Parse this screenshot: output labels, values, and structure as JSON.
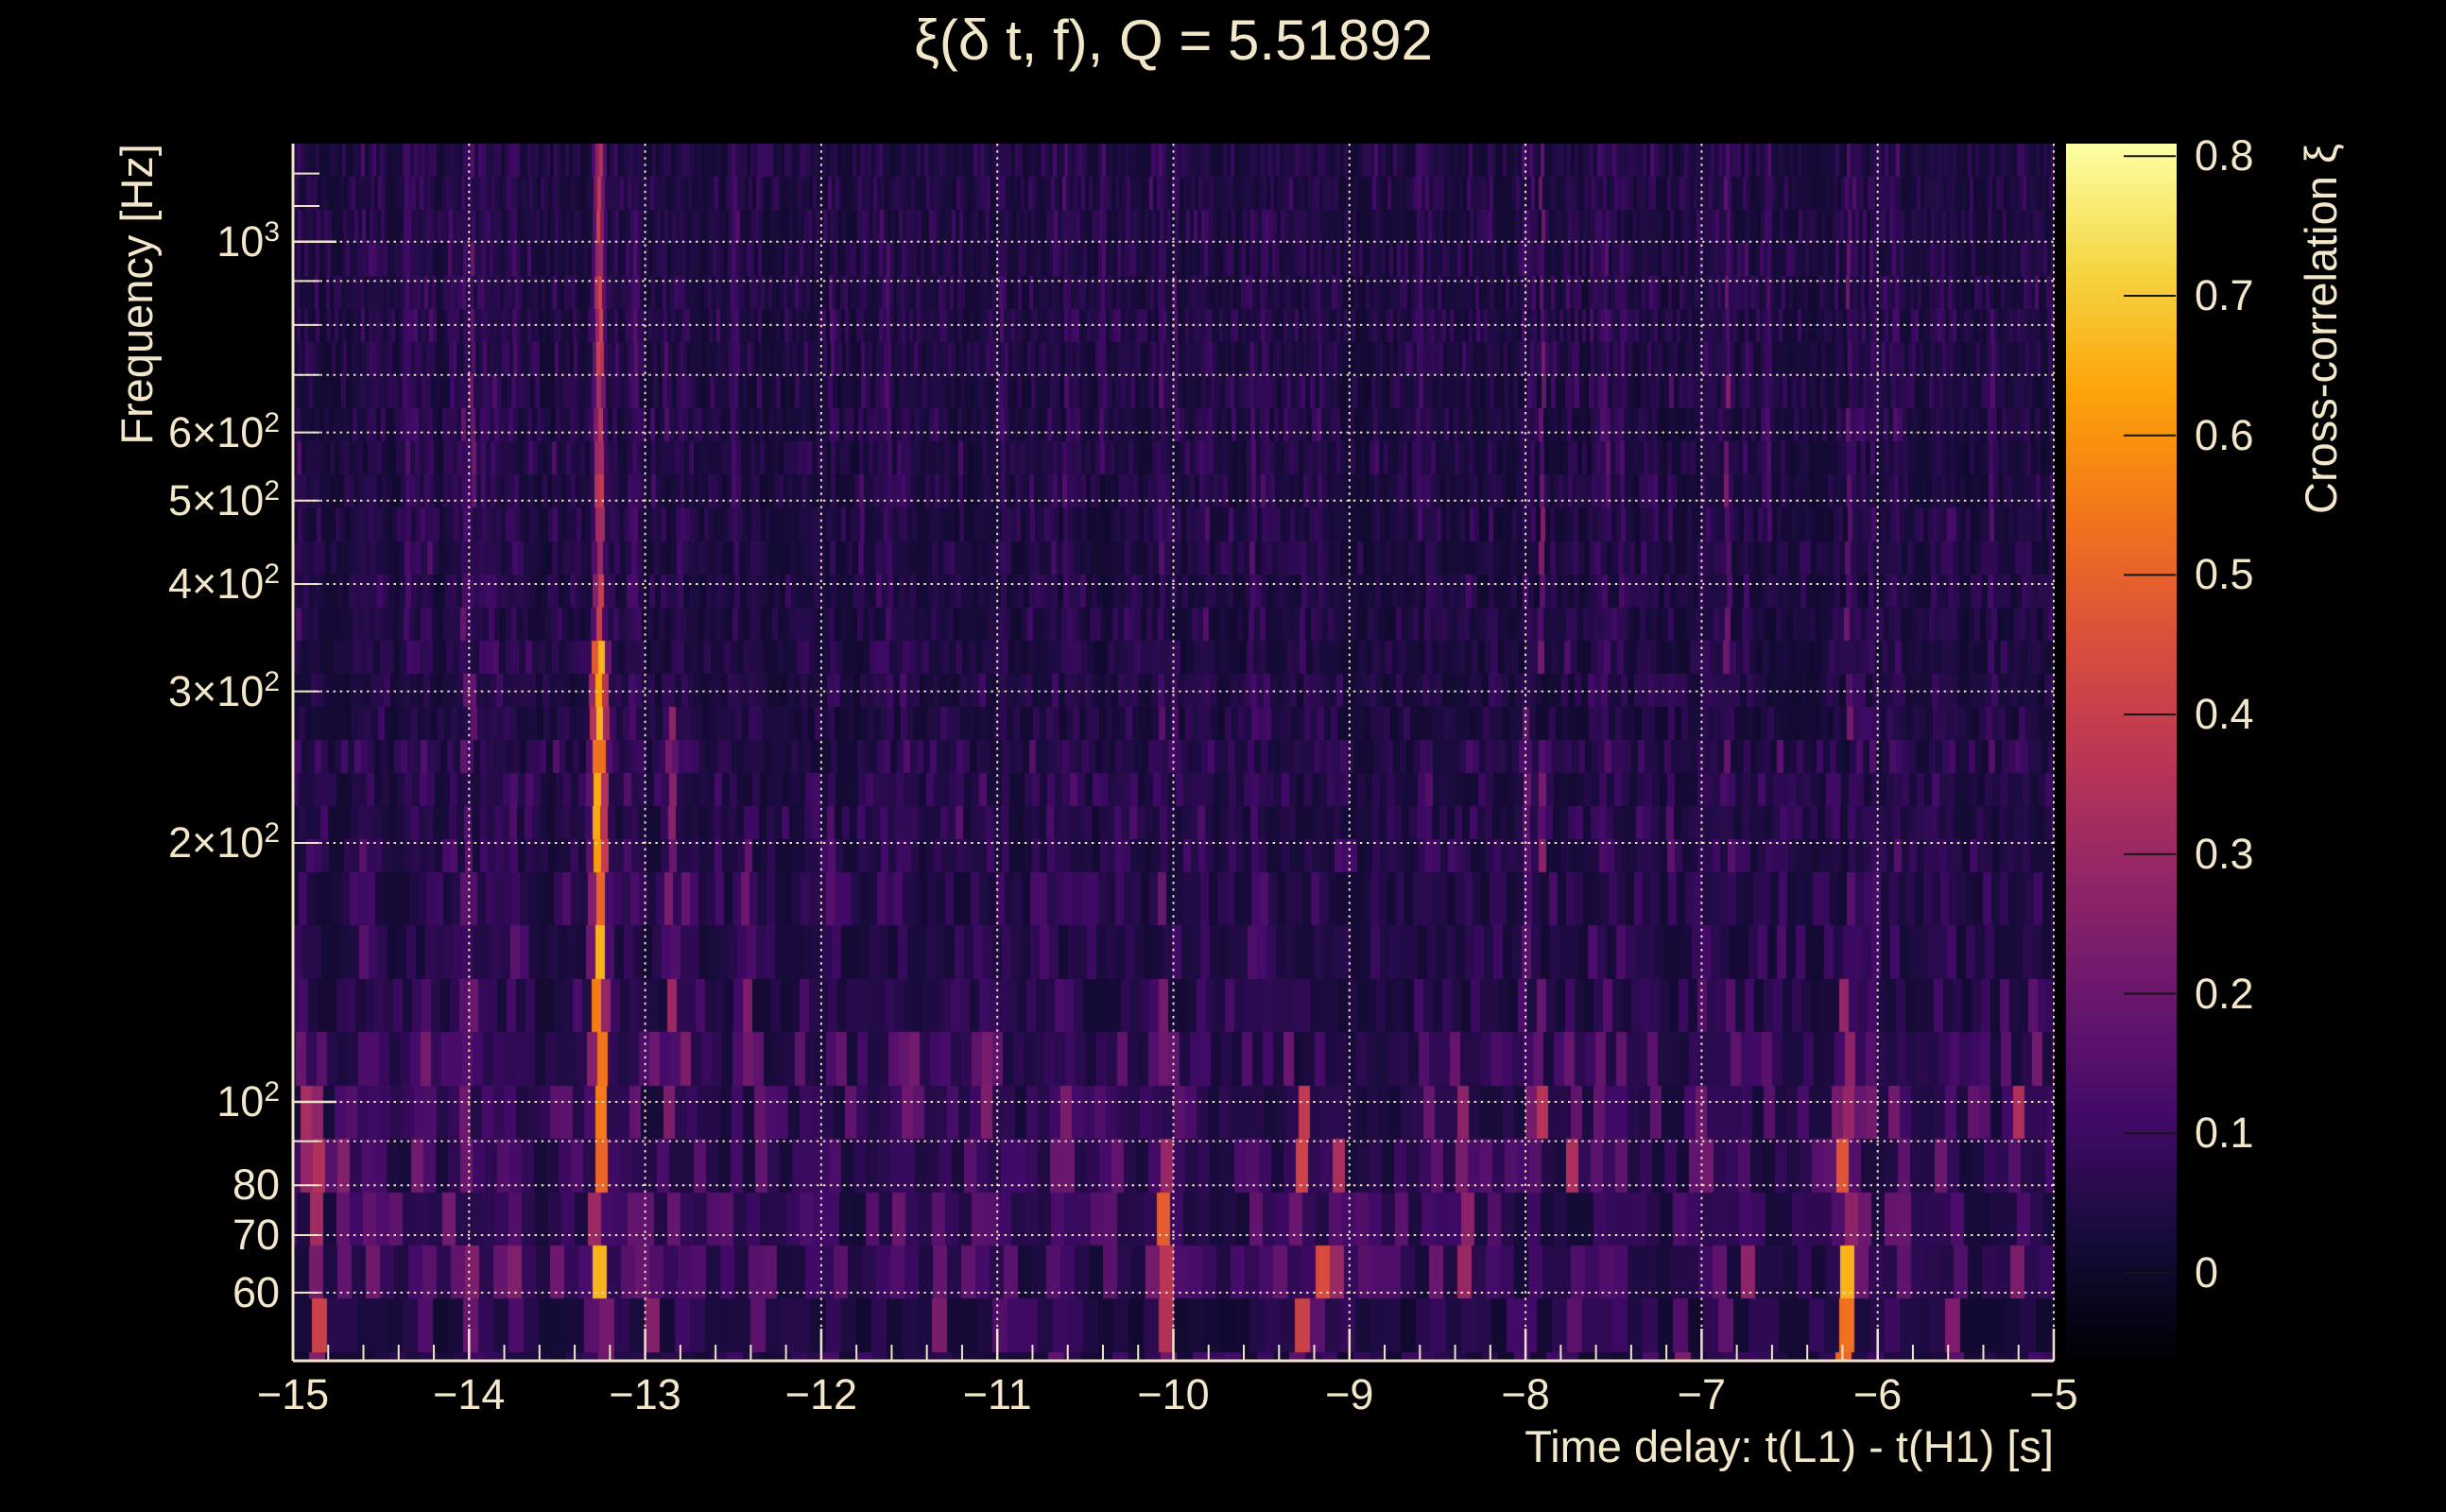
{
  "page": {
    "background": "#000000"
  },
  "colors": {
    "text": "#f2e7c9",
    "grid": "#ece0bf",
    "axis": "#efe5c6",
    "colorbar_tick": "#141414"
  },
  "chart_data": {
    "type": "heatmap",
    "title": "ξ(δ t, f), Q = 5.51892",
    "grid": "dotted",
    "noise_seed": 7,
    "x_axis": {
      "label": "Time delay: t(L1) - t(H1) [s]",
      "min": -15,
      "max": -5,
      "minor_tick_step": 0.2,
      "ticks": [
        {
          "value": -15,
          "label": "−15"
        },
        {
          "value": -14,
          "label": "−14"
        },
        {
          "value": -13,
          "label": "−13"
        },
        {
          "value": -12,
          "label": "−12"
        },
        {
          "value": -11,
          "label": "−11"
        },
        {
          "value": -10,
          "label": "−10"
        },
        {
          "value": -9,
          "label": "−9"
        },
        {
          "value": -8,
          "label": "−8"
        },
        {
          "value": -7,
          "label": "−7"
        },
        {
          "value": -6,
          "label": "−6"
        },
        {
          "value": -5,
          "label": "−5"
        }
      ]
    },
    "y_axis": {
      "label": "Frequency [Hz]",
      "scale": "log",
      "min": 50,
      "max": 1300,
      "ticks": [
        {
          "value": 1000,
          "base": "10",
          "exp": "3"
        },
        {
          "value": 600,
          "base": "6×10",
          "exp": "2"
        },
        {
          "value": 500,
          "base": "5×10",
          "exp": "2"
        },
        {
          "value": 400,
          "base": "4×10",
          "exp": "2"
        },
        {
          "value": 300,
          "base": "3×10",
          "exp": "2"
        },
        {
          "value": 200,
          "base": "2×10",
          "exp": "2"
        },
        {
          "value": 100,
          "base": "10",
          "exp": "2"
        },
        {
          "value": 80,
          "base": "80",
          "exp": ""
        },
        {
          "value": 70,
          "base": "70",
          "exp": ""
        },
        {
          "value": 60,
          "base": "60",
          "exp": ""
        }
      ],
      "grid_values": [
        60,
        70,
        80,
        90,
        100,
        200,
        300,
        400,
        500,
        600,
        700,
        800,
        900,
        1000
      ],
      "major_tick_values": [
        100,
        1000
      ],
      "extra_minor_ticks": [
        1100,
        1200
      ]
    },
    "colorbar": {
      "label": "Cross-correlation ξ",
      "min": -0.063,
      "max": 0.809,
      "colormap": "inferno",
      "ticks": [
        {
          "value": 0,
          "label": "0"
        },
        {
          "value": 0.1,
          "label": "0.1"
        },
        {
          "value": 0.2,
          "label": "0.2"
        },
        {
          "value": 0.3,
          "label": "0.3"
        },
        {
          "value": 0.4,
          "label": "0.4"
        },
        {
          "value": 0.5,
          "label": "0.5"
        },
        {
          "value": 0.6,
          "label": "0.6"
        },
        {
          "value": 0.7,
          "label": "0.7"
        },
        {
          "value": 0.8,
          "label": "0.8"
        }
      ]
    },
    "hotspots": [
      {
        "t": -14.93,
        "f_lo": 85,
        "f_hi": 112,
        "xi": 0.3,
        "sigma_s": 0.022
      },
      {
        "t": -14.85,
        "f_lo": 52,
        "f_hi": 100,
        "xi": 0.36,
        "sigma_s": 0.024
      },
      {
        "t": -14.7,
        "f_lo": 70,
        "f_hi": 95,
        "xi": 0.26,
        "sigma_s": 0.02
      },
      {
        "t": -14.55,
        "f_lo": 55,
        "f_hi": 90,
        "xi": 0.22,
        "sigma_s": 0.022
      },
      {
        "t": -14.35,
        "f_lo": 350,
        "f_hi": 1300,
        "xi": 0.13,
        "sigma_s": 0.018
      },
      {
        "t": -13.26,
        "f_lo": 50,
        "f_hi": 100,
        "xi": 0.58,
        "sigma_s": 0.028
      },
      {
        "t": -13.26,
        "f_lo": 95,
        "f_hi": 330,
        "xi": 0.63,
        "sigma_s": 0.032
      },
      {
        "t": -13.26,
        "f_lo": 300,
        "f_hi": 1300,
        "xi": 0.38,
        "sigma_s": 0.022
      },
      {
        "t": -13.05,
        "f_lo": 380,
        "f_hi": 1000,
        "xi": 0.14,
        "sigma_s": 0.016
      },
      {
        "t": -12.97,
        "f_lo": 55,
        "f_hi": 78,
        "xi": 0.3,
        "sigma_s": 0.02
      },
      {
        "t": -12.85,
        "f_lo": 95,
        "f_hi": 260,
        "xi": 0.26,
        "sigma_s": 0.022
      },
      {
        "t": -12.5,
        "f_lo": 480,
        "f_hi": 1300,
        "xi": 0.12,
        "sigma_s": 0.016
      },
      {
        "t": -12.42,
        "f_lo": 110,
        "f_hi": 190,
        "xi": 0.22,
        "sigma_s": 0.02
      },
      {
        "t": -12.35,
        "f_lo": 55,
        "f_hi": 95,
        "xi": 0.22,
        "sigma_s": 0.022
      },
      {
        "t": -11.9,
        "f_lo": 50,
        "f_hi": 70,
        "xi": 0.2,
        "sigma_s": 0.02
      },
      {
        "t": -11.62,
        "f_lo": 240,
        "f_hi": 900,
        "xi": 0.13,
        "sigma_s": 0.016
      },
      {
        "t": -11.55,
        "f_lo": 60,
        "f_hi": 100,
        "xi": 0.19,
        "sigma_s": 0.02
      },
      {
        "t": -11.32,
        "f_lo": 55,
        "f_hi": 90,
        "xi": 0.21,
        "sigma_s": 0.022
      },
      {
        "t": -11.05,
        "f_lo": 80,
        "f_hi": 115,
        "xi": 0.27,
        "sigma_s": 0.022
      },
      {
        "t": -10.67,
        "f_lo": 50,
        "f_hi": 80,
        "xi": 0.18,
        "sigma_s": 0.024
      },
      {
        "t": -10.4,
        "f_lo": 580,
        "f_hi": 1300,
        "xi": 0.12,
        "sigma_s": 0.016
      },
      {
        "t": -10.37,
        "f_lo": 60,
        "f_hi": 95,
        "xi": 0.18,
        "sigma_s": 0.02
      },
      {
        "t": -10.06,
        "f_lo": 50,
        "f_hi": 88,
        "xi": 0.45,
        "sigma_s": 0.026
      },
      {
        "t": -10.06,
        "f_lo": 86,
        "f_hi": 130,
        "xi": 0.2,
        "sigma_s": 0.022
      },
      {
        "t": -9.55,
        "f_lo": 200,
        "f_hi": 700,
        "xi": 0.13,
        "sigma_s": 0.016
      },
      {
        "t": -9.27,
        "f_lo": 50,
        "f_hi": 92,
        "xi": 0.38,
        "sigma_s": 0.024
      },
      {
        "t": -9.15,
        "f_lo": 50,
        "f_hi": 66,
        "xi": 0.52,
        "sigma_s": 0.02
      },
      {
        "t": -9.05,
        "f_lo": 55,
        "f_hi": 85,
        "xi": 0.42,
        "sigma_s": 0.022
      },
      {
        "t": -8.6,
        "f_lo": 500,
        "f_hi": 1200,
        "xi": 0.12,
        "sigma_s": 0.016
      },
      {
        "t": -8.52,
        "f_lo": 55,
        "f_hi": 80,
        "xi": 0.21,
        "sigma_s": 0.022
      },
      {
        "t": -8.34,
        "f_lo": 62,
        "f_hi": 95,
        "xi": 0.36,
        "sigma_s": 0.024
      },
      {
        "t": -8.13,
        "f_lo": 60,
        "f_hi": 90,
        "xi": 0.18,
        "sigma_s": 0.02
      },
      {
        "t": -8.0,
        "f_lo": 140,
        "f_hi": 260,
        "xi": 0.18,
        "sigma_s": 0.02
      },
      {
        "t": -7.73,
        "f_lo": 88,
        "f_hi": 112,
        "xi": 0.3,
        "sigma_s": 0.022
      },
      {
        "t": -7.57,
        "f_lo": 80,
        "f_hi": 105,
        "xi": 0.18,
        "sigma_s": 0.02
      },
      {
        "t": -7.45,
        "f_lo": 300,
        "f_hi": 900,
        "xi": 0.12,
        "sigma_s": 0.016
      },
      {
        "t": -7.1,
        "f_lo": 50,
        "f_hi": 75,
        "xi": 0.24,
        "sigma_s": 0.022
      },
      {
        "t": -6.62,
        "f_lo": 480,
        "f_hi": 1300,
        "xi": 0.12,
        "sigma_s": 0.016
      },
      {
        "t": -6.55,
        "f_lo": 120,
        "f_hi": 250,
        "xi": 0.15,
        "sigma_s": 0.018
      },
      {
        "t": -6.18,
        "f_lo": 50,
        "f_hi": 82,
        "xi": 0.58,
        "sigma_s": 0.026
      },
      {
        "t": -6.18,
        "f_lo": 80,
        "f_hi": 120,
        "xi": 0.28,
        "sigma_s": 0.022
      },
      {
        "t": -5.87,
        "f_lo": 50,
        "f_hi": 70,
        "xi": 0.3,
        "sigma_s": 0.02
      },
      {
        "t": -5.57,
        "f_lo": 50,
        "f_hi": 75,
        "xi": 0.22,
        "sigma_s": 0.018
      },
      {
        "t": -5.35,
        "f_lo": 250,
        "f_hi": 800,
        "xi": 0.13,
        "sigma_s": 0.016
      },
      {
        "t": -5.2,
        "f_lo": 62,
        "f_hi": 100,
        "xi": 0.3,
        "sigma_s": 0.022
      },
      {
        "t": -5.1,
        "f_lo": 95,
        "f_hi": 125,
        "xi": 0.22,
        "sigma_s": 0.02
      }
    ]
  }
}
